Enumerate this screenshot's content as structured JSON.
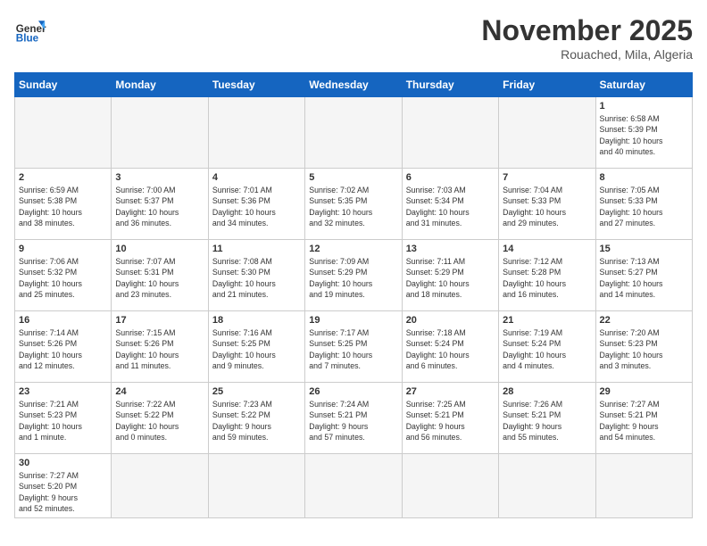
{
  "header": {
    "logo_general": "General",
    "logo_blue": "Blue",
    "month_year": "November 2025",
    "location": "Rouached, Mila, Algeria"
  },
  "days_of_week": [
    "Sunday",
    "Monday",
    "Tuesday",
    "Wednesday",
    "Thursday",
    "Friday",
    "Saturday"
  ],
  "weeks": [
    [
      {
        "day": "",
        "info": ""
      },
      {
        "day": "",
        "info": ""
      },
      {
        "day": "",
        "info": ""
      },
      {
        "day": "",
        "info": ""
      },
      {
        "day": "",
        "info": ""
      },
      {
        "day": "",
        "info": ""
      },
      {
        "day": "1",
        "info": "Sunrise: 6:58 AM\nSunset: 5:39 PM\nDaylight: 10 hours\nand 40 minutes."
      }
    ],
    [
      {
        "day": "2",
        "info": "Sunrise: 6:59 AM\nSunset: 5:38 PM\nDaylight: 10 hours\nand 38 minutes."
      },
      {
        "day": "3",
        "info": "Sunrise: 7:00 AM\nSunset: 5:37 PM\nDaylight: 10 hours\nand 36 minutes."
      },
      {
        "day": "4",
        "info": "Sunrise: 7:01 AM\nSunset: 5:36 PM\nDaylight: 10 hours\nand 34 minutes."
      },
      {
        "day": "5",
        "info": "Sunrise: 7:02 AM\nSunset: 5:35 PM\nDaylight: 10 hours\nand 32 minutes."
      },
      {
        "day": "6",
        "info": "Sunrise: 7:03 AM\nSunset: 5:34 PM\nDaylight: 10 hours\nand 31 minutes."
      },
      {
        "day": "7",
        "info": "Sunrise: 7:04 AM\nSunset: 5:33 PM\nDaylight: 10 hours\nand 29 minutes."
      },
      {
        "day": "8",
        "info": "Sunrise: 7:05 AM\nSunset: 5:33 PM\nDaylight: 10 hours\nand 27 minutes."
      }
    ],
    [
      {
        "day": "9",
        "info": "Sunrise: 7:06 AM\nSunset: 5:32 PM\nDaylight: 10 hours\nand 25 minutes."
      },
      {
        "day": "10",
        "info": "Sunrise: 7:07 AM\nSunset: 5:31 PM\nDaylight: 10 hours\nand 23 minutes."
      },
      {
        "day": "11",
        "info": "Sunrise: 7:08 AM\nSunset: 5:30 PM\nDaylight: 10 hours\nand 21 minutes."
      },
      {
        "day": "12",
        "info": "Sunrise: 7:09 AM\nSunset: 5:29 PM\nDaylight: 10 hours\nand 19 minutes."
      },
      {
        "day": "13",
        "info": "Sunrise: 7:11 AM\nSunset: 5:29 PM\nDaylight: 10 hours\nand 18 minutes."
      },
      {
        "day": "14",
        "info": "Sunrise: 7:12 AM\nSunset: 5:28 PM\nDaylight: 10 hours\nand 16 minutes."
      },
      {
        "day": "15",
        "info": "Sunrise: 7:13 AM\nSunset: 5:27 PM\nDaylight: 10 hours\nand 14 minutes."
      }
    ],
    [
      {
        "day": "16",
        "info": "Sunrise: 7:14 AM\nSunset: 5:26 PM\nDaylight: 10 hours\nand 12 minutes."
      },
      {
        "day": "17",
        "info": "Sunrise: 7:15 AM\nSunset: 5:26 PM\nDaylight: 10 hours\nand 11 minutes."
      },
      {
        "day": "18",
        "info": "Sunrise: 7:16 AM\nSunset: 5:25 PM\nDaylight: 10 hours\nand 9 minutes."
      },
      {
        "day": "19",
        "info": "Sunrise: 7:17 AM\nSunset: 5:25 PM\nDaylight: 10 hours\nand 7 minutes."
      },
      {
        "day": "20",
        "info": "Sunrise: 7:18 AM\nSunset: 5:24 PM\nDaylight: 10 hours\nand 6 minutes."
      },
      {
        "day": "21",
        "info": "Sunrise: 7:19 AM\nSunset: 5:24 PM\nDaylight: 10 hours\nand 4 minutes."
      },
      {
        "day": "22",
        "info": "Sunrise: 7:20 AM\nSunset: 5:23 PM\nDaylight: 10 hours\nand 3 minutes."
      }
    ],
    [
      {
        "day": "23",
        "info": "Sunrise: 7:21 AM\nSunset: 5:23 PM\nDaylight: 10 hours\nand 1 minute."
      },
      {
        "day": "24",
        "info": "Sunrise: 7:22 AM\nSunset: 5:22 PM\nDaylight: 10 hours\nand 0 minutes."
      },
      {
        "day": "25",
        "info": "Sunrise: 7:23 AM\nSunset: 5:22 PM\nDaylight: 9 hours\nand 59 minutes."
      },
      {
        "day": "26",
        "info": "Sunrise: 7:24 AM\nSunset: 5:21 PM\nDaylight: 9 hours\nand 57 minutes."
      },
      {
        "day": "27",
        "info": "Sunrise: 7:25 AM\nSunset: 5:21 PM\nDaylight: 9 hours\nand 56 minutes."
      },
      {
        "day": "28",
        "info": "Sunrise: 7:26 AM\nSunset: 5:21 PM\nDaylight: 9 hours\nand 55 minutes."
      },
      {
        "day": "29",
        "info": "Sunrise: 7:27 AM\nSunset: 5:21 PM\nDaylight: 9 hours\nand 54 minutes."
      }
    ],
    [
      {
        "day": "30",
        "info": "Sunrise: 7:27 AM\nSunset: 5:20 PM\nDaylight: 9 hours\nand 52 minutes."
      },
      {
        "day": "",
        "info": ""
      },
      {
        "day": "",
        "info": ""
      },
      {
        "day": "",
        "info": ""
      },
      {
        "day": "",
        "info": ""
      },
      {
        "day": "",
        "info": ""
      },
      {
        "day": "",
        "info": ""
      }
    ]
  ]
}
